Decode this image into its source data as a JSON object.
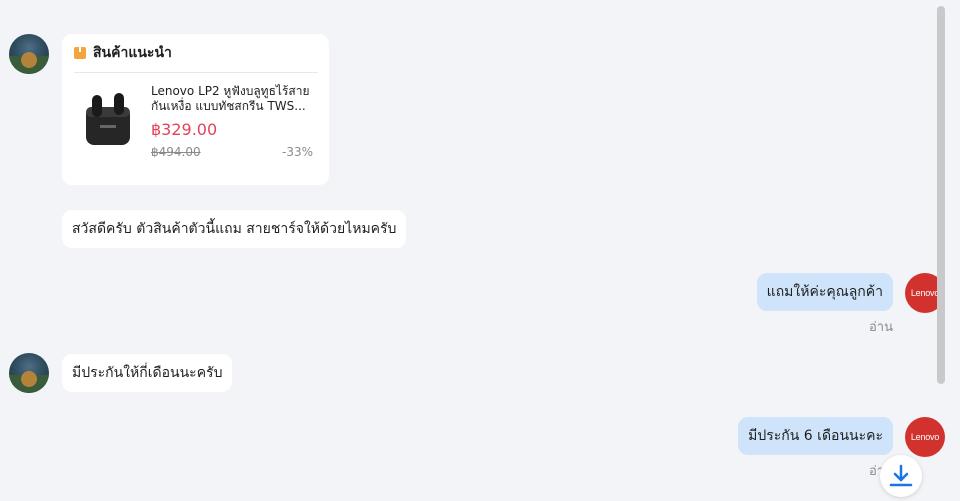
{
  "recommend_card": {
    "title": "สินค้าแนะนำ",
    "product_name": "Lenovo LP2 หูฟังบลูทูธไร้สาย กันเหงื่อ แบบทัชสกรีน TWS...",
    "price": "฿329.00",
    "old_price": "฿494.00",
    "discount": "-33%"
  },
  "messages": [
    {
      "text": "สวัสดีครับ ตัวสินค้าตัวนี้แถม สายชาร์จให้ด้วยไหมครับ"
    },
    {
      "text": "แถมให้ค่ะคุณลูกค้า",
      "read": "อ่าน"
    },
    {
      "text": "มีประกันให้กี่เดือนนะครับ"
    },
    {
      "text": "มีประกัน 6 เดือนนะคะ",
      "read": "อ่าน"
    }
  ],
  "shop_avatar_text": "Lenovo",
  "colors": {
    "background": "#f3f4f7",
    "my_bubble": "#cfe4fb",
    "price": "#e0445c",
    "shop_avatar": "#d1322e",
    "download_icon": "#1a73e8"
  },
  "icons": {
    "card_icon": "package-icon",
    "scroll_button": "download-arrow-icon"
  }
}
